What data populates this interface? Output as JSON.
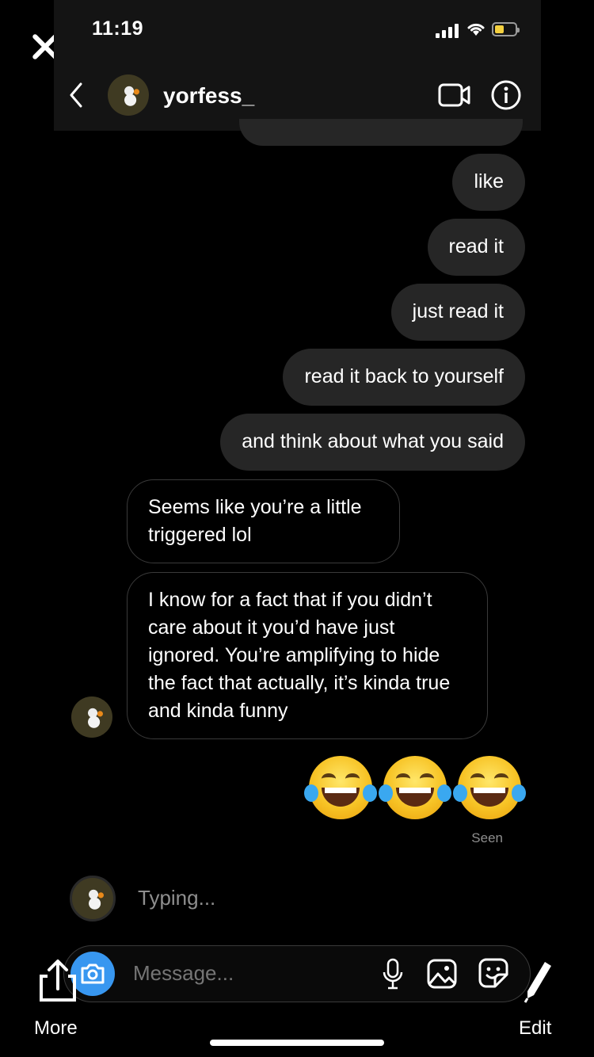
{
  "status_bar": {
    "time": "11:19"
  },
  "header": {
    "username": "yorfess_"
  },
  "icons": {
    "close": "close-icon",
    "back": "chevron-left-icon",
    "video": "video-call-icon",
    "info": "info-icon",
    "camera": "camera-icon",
    "mic": "microphone-icon",
    "gallery": "gallery-icon",
    "sticker": "sticker-icon",
    "share": "share-icon",
    "edit": "pen-icon"
  },
  "messages": [
    {
      "from": "me",
      "text": "like"
    },
    {
      "from": "me",
      "text": "read it"
    },
    {
      "from": "me",
      "text": "just read it"
    },
    {
      "from": "me",
      "text": "read it back to yourself"
    },
    {
      "from": "me",
      "text": "and think about what you said"
    },
    {
      "from": "them",
      "text": "Seems like you’re a little triggered lol"
    },
    {
      "from": "them",
      "text": "I know for a fact that if you didn’t care about it you’d have just ignored. You’re amplifying to hide the fact that actually, it’s kinda true and kinda funny"
    },
    {
      "from": "me",
      "emoji": "face-with-tears-of-joy",
      "count": 3
    }
  ],
  "seen_label": "Seen",
  "typing_label": "Typing...",
  "composer": {
    "placeholder": "Message..."
  },
  "editor": {
    "more_label": "More",
    "edit_label": "Edit"
  },
  "colors": {
    "background": "#000000",
    "sent_bubble": "#262626",
    "camera_button": "#3897f0",
    "muted_text": "#8e8e8e",
    "battery_fill": "#f4d03f"
  }
}
